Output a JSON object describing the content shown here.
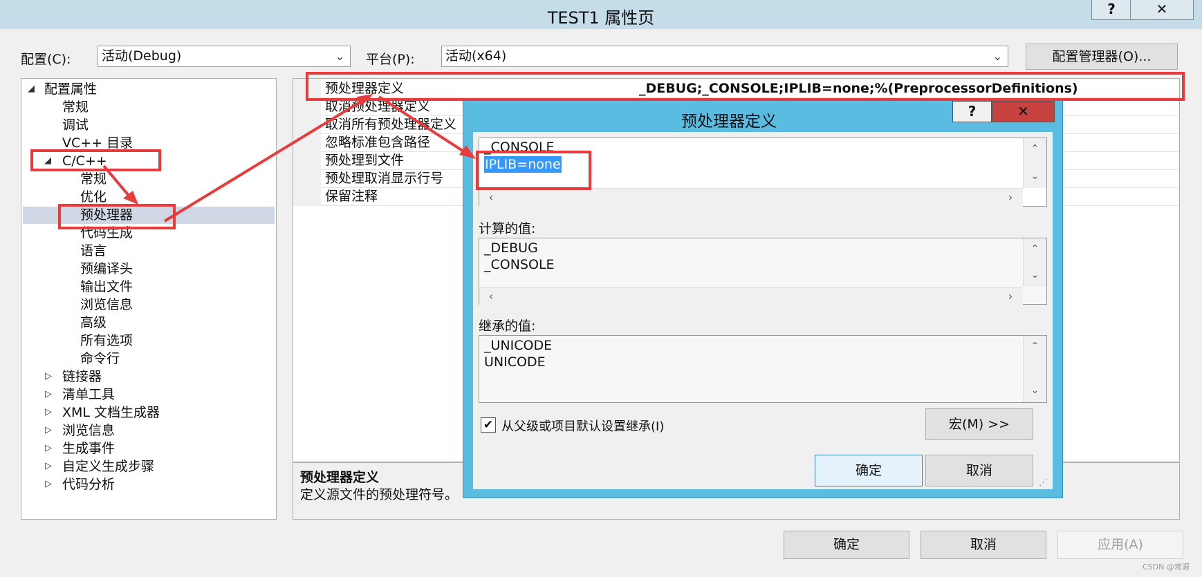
{
  "window": {
    "title": "TEST1 属性页",
    "help_label": "?",
    "close_label": "✕"
  },
  "toolbar": {
    "config_label": "配置(C):",
    "config_value": "活动(Debug)",
    "platform_label": "平台(P):",
    "platform_value": "活动(x64)",
    "config_manager_label": "配置管理器(O)..."
  },
  "tree": {
    "root": "配置属性",
    "items": [
      "常规",
      "调试",
      "VC++ 目录"
    ],
    "cpp": "C/C++",
    "cpp_children": [
      "常规",
      "优化",
      "预处理器",
      "代码生成",
      "语言",
      "预编译头",
      "输出文件",
      "浏览信息",
      "高级",
      "所有选项",
      "命令行"
    ],
    "collapsed": [
      "链接器",
      "清单工具",
      "XML 文档生成器",
      "浏览信息",
      "生成事件",
      "自定义生成步骤",
      "代码分析"
    ]
  },
  "grid": {
    "rows": [
      "预处理器定义",
      "取消预处理器定义",
      "取消所有预处理器定义",
      "忽略标准包含路径",
      "预处理到文件",
      "预处理取消显示行号",
      "保留注释"
    ],
    "first_value": "_DEBUG;_CONSOLE;IPLIB=none;%(PreprocessorDefinitions)"
  },
  "description": {
    "title": "预处理器定义",
    "text": "定义源文件的预处理符号。"
  },
  "dialog": {
    "title": "预处理器定义",
    "help_label": "?",
    "close_label": "✕",
    "edit_lines": [
      "_CONSOLE",
      "IPLIB=none"
    ],
    "computed_label": "计算的值:",
    "computed_lines": [
      "_DEBUG",
      "_CONSOLE"
    ],
    "inherited_label": "继承的值:",
    "inherited_lines": [
      "_UNICODE",
      "UNICODE"
    ],
    "inherit_checkbox_label": "从父级或项目默认设置继承(I)",
    "inherit_checked": true,
    "macro_button": "宏(M) >>",
    "ok_label": "确定",
    "cancel_label": "取消"
  },
  "footer": {
    "ok_label": "确定",
    "cancel_label": "取消",
    "apply_label": "应用(A)"
  },
  "watermark": "CSDN @常源",
  "colors": {
    "annotation": "#e83c3c",
    "selection": "#3399ff",
    "dialog_frame": "#5bbce2",
    "title_bar": "#c4dde9"
  }
}
